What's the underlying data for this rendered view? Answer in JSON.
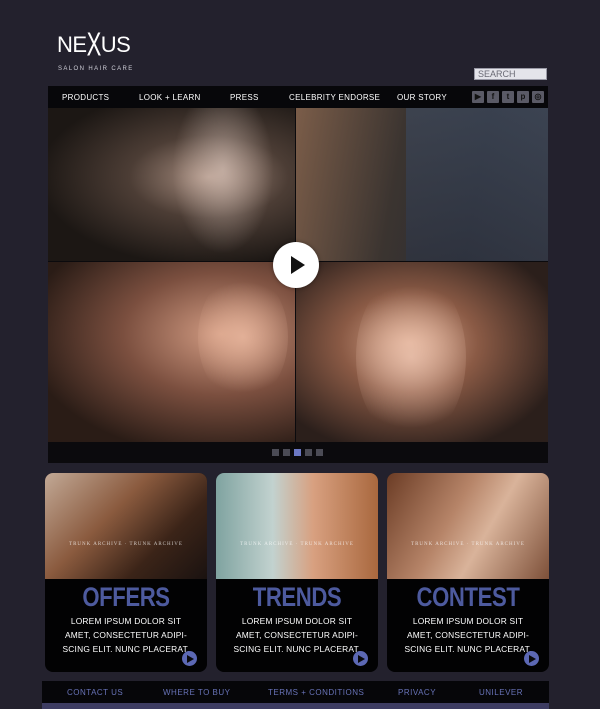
{
  "logo": {
    "word_pre": "NE",
    "word_x": "X",
    "word_post": "US",
    "tagline": "SALON HAIR CARE"
  },
  "search": {
    "placeholder": "SEARCH"
  },
  "nav": {
    "items": [
      "PRODUCTS",
      "LOOK + LEARN",
      "PRESS",
      "CELEBRITY ENDORSE",
      "OUR STORY"
    ],
    "social_icons": [
      "youtube-icon",
      "facebook-icon",
      "twitter-icon",
      "pinterest-icon",
      "instagram-icon"
    ]
  },
  "hero": {
    "slide_count": 5,
    "active_slide": 3
  },
  "cards": [
    {
      "title": "OFFERS",
      "archive": "TRUNK ARCHIVE · TRUNK ARCHIVE",
      "text": "LOREM IPSUM DOLOR SIT AMET, CONSECTETUR ADIPI-SCING ELIT. NUNC PLACERAT."
    },
    {
      "title": "TRENDS",
      "archive": "TRUNK ARCHIVE · TRUNK ARCHIVE",
      "text": "LOREM IPSUM DOLOR SIT AMET, CONSECTETUR ADIPI-SCING ELIT. NUNC PLACERAT."
    },
    {
      "title": "CONTEST",
      "archive": "TRUNK ARCHIVE · TRUNK ARCHIVE",
      "text": "LOREM IPSUM DOLOR SIT AMET, CONSECTETUR ADIPI-SCING ELIT. NUNC PLACERAT."
    }
  ],
  "footer": {
    "links": [
      "CONTACT US",
      "WHERE TO BUY",
      "TERMS + CONDITIONS",
      "PRIVACY",
      "UNILEVER"
    ]
  },
  "colors": {
    "background": "#23212d",
    "accent": "#5c68b4",
    "nav_bg": "#07070a"
  }
}
